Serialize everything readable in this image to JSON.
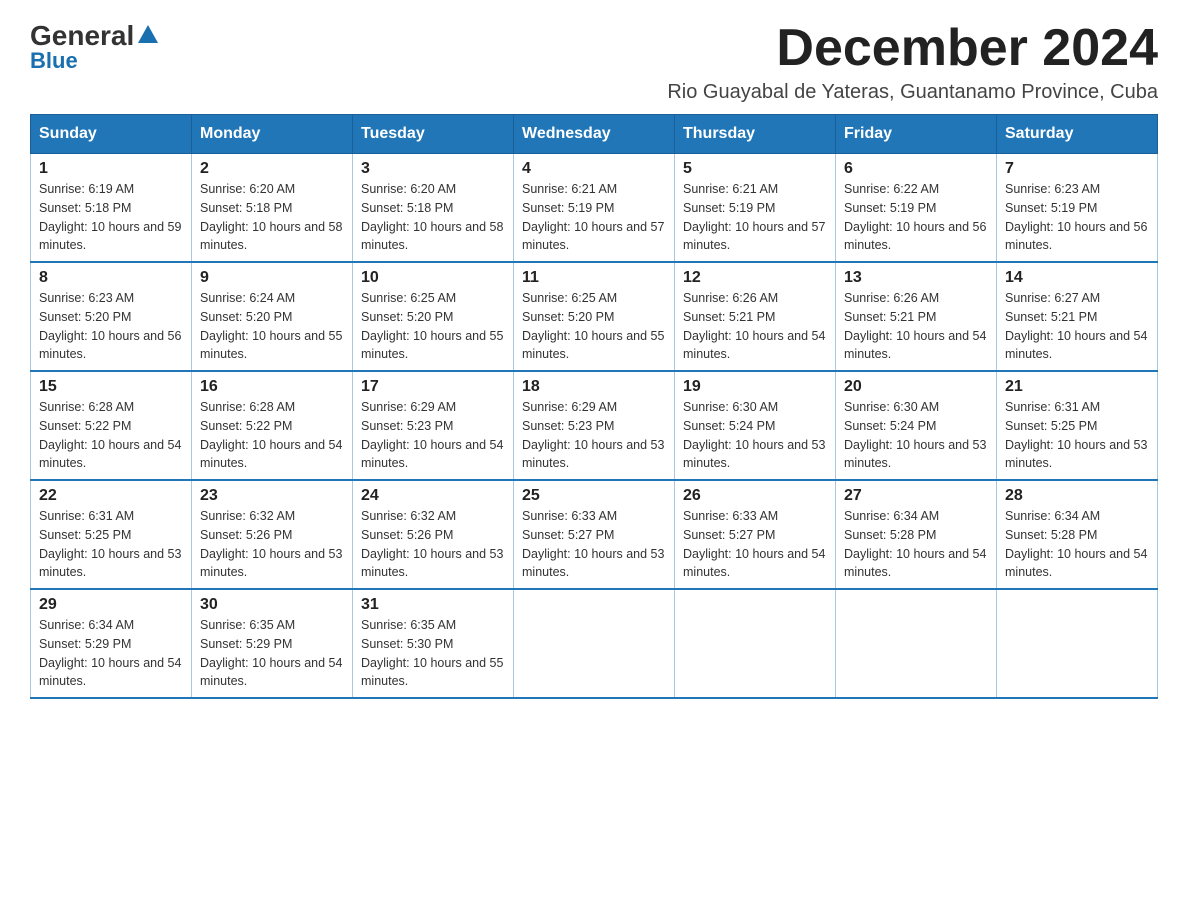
{
  "logo": {
    "general": "General",
    "blue": "Blue"
  },
  "header": {
    "title": "December 2024",
    "location": "Rio Guayabal de Yateras, Guantanamo Province, Cuba"
  },
  "days_of_week": [
    "Sunday",
    "Monday",
    "Tuesday",
    "Wednesday",
    "Thursday",
    "Friday",
    "Saturday"
  ],
  "weeks": [
    [
      {
        "num": "1",
        "sunrise": "6:19 AM",
        "sunset": "5:18 PM",
        "daylight": "10 hours and 59 minutes."
      },
      {
        "num": "2",
        "sunrise": "6:20 AM",
        "sunset": "5:18 PM",
        "daylight": "10 hours and 58 minutes."
      },
      {
        "num": "3",
        "sunrise": "6:20 AM",
        "sunset": "5:18 PM",
        "daylight": "10 hours and 58 minutes."
      },
      {
        "num": "4",
        "sunrise": "6:21 AM",
        "sunset": "5:19 PM",
        "daylight": "10 hours and 57 minutes."
      },
      {
        "num": "5",
        "sunrise": "6:21 AM",
        "sunset": "5:19 PM",
        "daylight": "10 hours and 57 minutes."
      },
      {
        "num": "6",
        "sunrise": "6:22 AM",
        "sunset": "5:19 PM",
        "daylight": "10 hours and 56 minutes."
      },
      {
        "num": "7",
        "sunrise": "6:23 AM",
        "sunset": "5:19 PM",
        "daylight": "10 hours and 56 minutes."
      }
    ],
    [
      {
        "num": "8",
        "sunrise": "6:23 AM",
        "sunset": "5:20 PM",
        "daylight": "10 hours and 56 minutes."
      },
      {
        "num": "9",
        "sunrise": "6:24 AM",
        "sunset": "5:20 PM",
        "daylight": "10 hours and 55 minutes."
      },
      {
        "num": "10",
        "sunrise": "6:25 AM",
        "sunset": "5:20 PM",
        "daylight": "10 hours and 55 minutes."
      },
      {
        "num": "11",
        "sunrise": "6:25 AM",
        "sunset": "5:20 PM",
        "daylight": "10 hours and 55 minutes."
      },
      {
        "num": "12",
        "sunrise": "6:26 AM",
        "sunset": "5:21 PM",
        "daylight": "10 hours and 54 minutes."
      },
      {
        "num": "13",
        "sunrise": "6:26 AM",
        "sunset": "5:21 PM",
        "daylight": "10 hours and 54 minutes."
      },
      {
        "num": "14",
        "sunrise": "6:27 AM",
        "sunset": "5:21 PM",
        "daylight": "10 hours and 54 minutes."
      }
    ],
    [
      {
        "num": "15",
        "sunrise": "6:28 AM",
        "sunset": "5:22 PM",
        "daylight": "10 hours and 54 minutes."
      },
      {
        "num": "16",
        "sunrise": "6:28 AM",
        "sunset": "5:22 PM",
        "daylight": "10 hours and 54 minutes."
      },
      {
        "num": "17",
        "sunrise": "6:29 AM",
        "sunset": "5:23 PM",
        "daylight": "10 hours and 54 minutes."
      },
      {
        "num": "18",
        "sunrise": "6:29 AM",
        "sunset": "5:23 PM",
        "daylight": "10 hours and 53 minutes."
      },
      {
        "num": "19",
        "sunrise": "6:30 AM",
        "sunset": "5:24 PM",
        "daylight": "10 hours and 53 minutes."
      },
      {
        "num": "20",
        "sunrise": "6:30 AM",
        "sunset": "5:24 PM",
        "daylight": "10 hours and 53 minutes."
      },
      {
        "num": "21",
        "sunrise": "6:31 AM",
        "sunset": "5:25 PM",
        "daylight": "10 hours and 53 minutes."
      }
    ],
    [
      {
        "num": "22",
        "sunrise": "6:31 AM",
        "sunset": "5:25 PM",
        "daylight": "10 hours and 53 minutes."
      },
      {
        "num": "23",
        "sunrise": "6:32 AM",
        "sunset": "5:26 PM",
        "daylight": "10 hours and 53 minutes."
      },
      {
        "num": "24",
        "sunrise": "6:32 AM",
        "sunset": "5:26 PM",
        "daylight": "10 hours and 53 minutes."
      },
      {
        "num": "25",
        "sunrise": "6:33 AM",
        "sunset": "5:27 PM",
        "daylight": "10 hours and 53 minutes."
      },
      {
        "num": "26",
        "sunrise": "6:33 AM",
        "sunset": "5:27 PM",
        "daylight": "10 hours and 54 minutes."
      },
      {
        "num": "27",
        "sunrise": "6:34 AM",
        "sunset": "5:28 PM",
        "daylight": "10 hours and 54 minutes."
      },
      {
        "num": "28",
        "sunrise": "6:34 AM",
        "sunset": "5:28 PM",
        "daylight": "10 hours and 54 minutes."
      }
    ],
    [
      {
        "num": "29",
        "sunrise": "6:34 AM",
        "sunset": "5:29 PM",
        "daylight": "10 hours and 54 minutes."
      },
      {
        "num": "30",
        "sunrise": "6:35 AM",
        "sunset": "5:29 PM",
        "daylight": "10 hours and 54 minutes."
      },
      {
        "num": "31",
        "sunrise": "6:35 AM",
        "sunset": "5:30 PM",
        "daylight": "10 hours and 55 minutes."
      },
      null,
      null,
      null,
      null
    ]
  ]
}
